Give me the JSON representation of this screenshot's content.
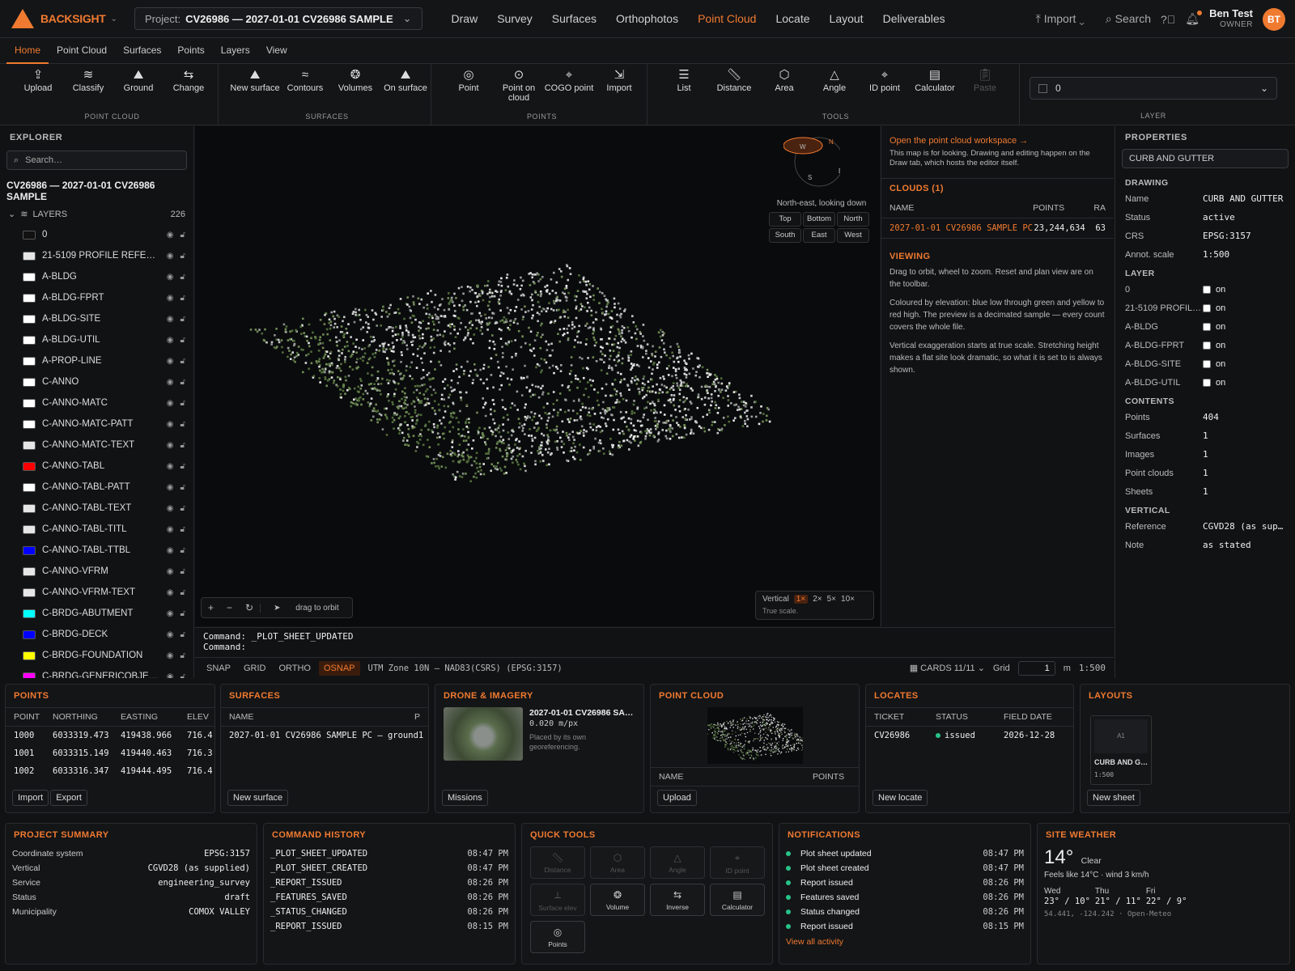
{
  "app": {
    "name": "BACKSIGHT",
    "project_label": "Project:",
    "project_value": "CV26986 — 2027-01-01 CV26986 SAMPLE"
  },
  "topnav": [
    "Draw",
    "Survey",
    "Surfaces",
    "Orthophotos",
    "Point Cloud",
    "Locate",
    "Layout",
    "Deliverables"
  ],
  "topnav_active": "Point Cloud",
  "topright": {
    "import": "Import",
    "search": "Search",
    "user_name": "Ben Test",
    "user_role": "OWNER",
    "avatar": "BT"
  },
  "tabs": [
    "Home",
    "Point Cloud",
    "Surfaces",
    "Points",
    "Layers",
    "View"
  ],
  "ribbon": {
    "groups": [
      {
        "label": "POINT CLOUD",
        "buttons": [
          {
            "label": "Upload",
            "icon": "upload-icon"
          },
          {
            "label": "Classify",
            "icon": "layers-icon"
          },
          {
            "label": "Ground",
            "icon": "mountain-icon"
          },
          {
            "label": "Change",
            "icon": "arrows-icon"
          }
        ]
      },
      {
        "label": "SURFACES",
        "buttons": [
          {
            "label": "New surface",
            "icon": "mountain-icon"
          },
          {
            "label": "Contours",
            "icon": "waves-icon"
          },
          {
            "label": "Volumes",
            "icon": "circles-icon"
          },
          {
            "label": "On surface",
            "icon": "mountain-icon"
          }
        ]
      },
      {
        "label": "POINTS",
        "buttons": [
          {
            "label": "Point",
            "icon": "target-icon"
          },
          {
            "label": "Point on cloud",
            "icon": "circle-dot-icon"
          },
          {
            "label": "COGO point",
            "icon": "crosshair-icon"
          },
          {
            "label": "Import",
            "icon": "import-icon"
          }
        ]
      },
      {
        "label": "TOOLS",
        "buttons": [
          {
            "label": "List",
            "icon": "list-icon"
          },
          {
            "label": "Distance",
            "icon": "ruler-icon"
          },
          {
            "label": "Area",
            "icon": "hexagon-icon"
          },
          {
            "label": "Angle",
            "icon": "angle-icon"
          },
          {
            "label": "ID point",
            "icon": "crosshair-icon"
          },
          {
            "label": "Calculator",
            "icon": "calculator-icon"
          },
          {
            "label": "Paste",
            "icon": "clipboard-icon"
          }
        ]
      }
    ],
    "layer_label": "LAYER",
    "layer_value": "0"
  },
  "explorer": {
    "title": "EXPLORER",
    "search_placeholder": "Search…",
    "project": "CV26986 — 2027-01-01 CV26986 SAMPLE",
    "layers_label": "LAYERS",
    "layers_count": "226",
    "layers": [
      {
        "name": "0",
        "color": "#111111"
      },
      {
        "name": "21-5109 PROFILE REFERE…",
        "color": "#e6e6e6"
      },
      {
        "name": "A-BLDG",
        "color": "#ffffff"
      },
      {
        "name": "A-BLDG-FPRT",
        "color": "#ffffff"
      },
      {
        "name": "A-BLDG-SITE",
        "color": "#ffffff"
      },
      {
        "name": "A-BLDG-UTIL",
        "color": "#ffffff"
      },
      {
        "name": "A-PROP-LINE",
        "color": "#ffffff"
      },
      {
        "name": "C-ANNO",
        "color": "#ffffff"
      },
      {
        "name": "C-ANNO-MATC",
        "color": "#ffffff"
      },
      {
        "name": "C-ANNO-MATC-PATT",
        "color": "#ffffff"
      },
      {
        "name": "C-ANNO-MATC-TEXT",
        "color": "#e6e6e6"
      },
      {
        "name": "C-ANNO-TABL",
        "color": "#ff0000"
      },
      {
        "name": "C-ANNO-TABL-PATT",
        "color": "#ffffff"
      },
      {
        "name": "C-ANNO-TABL-TEXT",
        "color": "#e6e6e6"
      },
      {
        "name": "C-ANNO-TABL-TITL",
        "color": "#e6e6e6"
      },
      {
        "name": "C-ANNO-TABL-TTBL",
        "color": "#0000ff"
      },
      {
        "name": "C-ANNO-VFRM",
        "color": "#e6e6e6"
      },
      {
        "name": "C-ANNO-VFRM-TEXT",
        "color": "#e6e6e6"
      },
      {
        "name": "C-BRDG-ABUTMENT",
        "color": "#00ffff"
      },
      {
        "name": "C-BRDG-DECK",
        "color": "#0000ff"
      },
      {
        "name": "C-BRDG-FOUNDATION",
        "color": "#ffff00"
      },
      {
        "name": "C-BRDG-GENERICOBJECT",
        "color": "#ff00ff"
      }
    ]
  },
  "viewer": {
    "compass_caption": "North-east, looking down",
    "view_buttons": [
      "Top",
      "Bottom",
      "North",
      "South",
      "East",
      "West"
    ],
    "compass_letters": [
      "N",
      "W",
      "E",
      "S"
    ],
    "drag_hint": "drag to orbit",
    "vertical_label": "Vertical",
    "vertical_options": [
      "1×",
      "2×",
      "5×",
      "10×"
    ],
    "vertical_active": "1×",
    "vertical_caption": "True scale."
  },
  "infopanel": {
    "link": "Open the point cloud workspace →",
    "note": "This map is for looking. Drawing and editing happen on the Draw tab, which hosts the editor itself.",
    "clouds_title": "CLOUDS (1)",
    "clouds_headers": [
      "NAME",
      "POINTS",
      "RA"
    ],
    "clouds_row": [
      "2027-01-01 CV26986 SAMPLE PC",
      "23,244,634",
      "63"
    ],
    "viewing_title": "VIEWING",
    "viewing_paragraphs": [
      "Drag to orbit, wheel to zoom. Reset and plan view are on the toolbar.",
      "Coloured by elevation: blue low through green and yellow to red high. The preview is a decimated sample — every count covers the whole file.",
      "Vertical exaggeration starts at true scale. Stretching height makes a flat site look dramatic, so what it is set to is always shown."
    ]
  },
  "properties": {
    "title": "PROPERTIES",
    "name_input": "CURB AND GUTTER",
    "drawing_title": "DRAWING",
    "drawing": [
      [
        "Name",
        "CURB AND GUTTER"
      ],
      [
        "Status",
        "active"
      ],
      [
        "CRS",
        "EPSG:3157"
      ],
      [
        "Annot. scale",
        "1:500"
      ]
    ],
    "layer_title": "LAYER",
    "layers": [
      [
        "0",
        "on"
      ],
      [
        "21-5109 PROFIL…",
        "on"
      ],
      [
        "A-BLDG",
        "on"
      ],
      [
        "A-BLDG-FPRT",
        "on"
      ],
      [
        "A-BLDG-SITE",
        "on"
      ],
      [
        "A-BLDG-UTIL",
        "on"
      ]
    ],
    "contents_title": "CONTENTS",
    "contents": [
      [
        "Points",
        "404"
      ],
      [
        "Surfaces",
        "1"
      ],
      [
        "Images",
        "1"
      ],
      [
        "Point clouds",
        "1"
      ],
      [
        "Sheets",
        "1"
      ]
    ],
    "vertical_title": "VERTICAL",
    "vertical": [
      [
        "Reference",
        "CGVD28 (as sup…"
      ],
      [
        "Note",
        "as stated"
      ]
    ]
  },
  "command": {
    "line1_label": "Command:",
    "line1_value": "_PLOT_SHEET_UPDATED",
    "line2_label": "Command:"
  },
  "statusbar": {
    "toggles": [
      "SNAP",
      "GRID",
      "ORTHO",
      "OSNAP"
    ],
    "active_toggle": "OSNAP",
    "crs": "UTM Zone 10N — NAD83(CSRS) (EPSG:3157)",
    "cards": "CARDS 11/11",
    "grid_label": "Grid",
    "grid_value": "1",
    "grid_unit": "m",
    "scale": "1:500"
  },
  "cards": {
    "points": {
      "title": "POINTS",
      "headers": [
        "POINT",
        "NORTHING",
        "EASTING",
        "ELEV"
      ],
      "rows": [
        [
          "1000",
          "6033319.473",
          "419438.966",
          "716.4"
        ],
        [
          "1001",
          "6033315.149",
          "419440.463",
          "716.3"
        ],
        [
          "1002",
          "6033316.347",
          "419444.495",
          "716.4"
        ]
      ],
      "buttons": [
        "Import",
        "Export"
      ]
    },
    "surfaces": {
      "title": "SURFACES",
      "headers": [
        "NAME",
        "P"
      ],
      "rows": [
        [
          "2027-01-01 CV26986 SAMPLE PC — ground",
          "1"
        ]
      ],
      "button": "New surface"
    },
    "drone": {
      "title": "DRONE & IMAGERY",
      "name": "2027-01-01 CV26986 SAM…",
      "gsd": "0.020 m/px",
      "note": "Placed by its own georeferencing.",
      "button": "Missions"
    },
    "pointcloud": {
      "title": "POINT CLOUD",
      "headers": [
        "NAME",
        "POINTS"
      ],
      "button": "Upload"
    },
    "locates": {
      "title": "LOCATES",
      "headers": [
        "TICKET",
        "STATUS",
        "FIELD DATE"
      ],
      "rows": [
        [
          "CV26986",
          "issued",
          "2026-12-28"
        ]
      ],
      "button": "New locate"
    },
    "layouts": {
      "title": "LAYOUTS",
      "sheet_code": "A1",
      "sheet_name": "CURB AND G…",
      "sheet_scale": "1:500",
      "button": "New sheet"
    },
    "summary": {
      "title": "PROJECT SUMMARY",
      "rows": [
        [
          "Coordinate system",
          "EPSG:3157"
        ],
        [
          "Vertical",
          "CGVD28 (as supplied)"
        ],
        [
          "Service",
          "engineering_survey"
        ],
        [
          "Status",
          "draft"
        ],
        [
          "Municipality",
          "COMOX VALLEY"
        ]
      ]
    },
    "history": {
      "title": "COMMAND HISTORY",
      "rows": [
        [
          "_PLOT_SHEET_UPDATED",
          "08:47 PM"
        ],
        [
          "_PLOT_SHEET_CREATED",
          "08:47 PM"
        ],
        [
          "_REPORT_ISSUED",
          "08:26 PM"
        ],
        [
          "_FEATURES_SAVED",
          "08:26 PM"
        ],
        [
          "_STATUS_CHANGED",
          "08:26 PM"
        ],
        [
          "_REPORT_ISSUED",
          "08:15 PM"
        ]
      ]
    },
    "quicktools": {
      "title": "QUICK TOOLS",
      "tools": [
        {
          "label": "Distance",
          "enabled": false,
          "icon": "ruler-icon"
        },
        {
          "label": "Area",
          "enabled": false,
          "icon": "hexagon-icon"
        },
        {
          "label": "Angle",
          "enabled": false,
          "icon": "angle-icon"
        },
        {
          "label": "ID point",
          "enabled": false,
          "icon": "crosshair-icon"
        },
        {
          "label": "Surface elev",
          "enabled": false,
          "icon": "elevation-icon"
        },
        {
          "label": "Volume",
          "enabled": true,
          "icon": "circles-icon"
        },
        {
          "label": "Inverse",
          "enabled": true,
          "icon": "arrows-icon"
        },
        {
          "label": "Calculator",
          "enabled": true,
          "icon": "calculator-icon"
        },
        {
          "label": "Points",
          "enabled": true,
          "icon": "target-icon"
        }
      ]
    },
    "notifications": {
      "title": "NOTIFICATIONS",
      "rows": [
        [
          "Plot sheet updated",
          "08:47 PM"
        ],
        [
          "Plot sheet created",
          "08:47 PM"
        ],
        [
          "Report issued",
          "08:26 PM"
        ],
        [
          "Features saved",
          "08:26 PM"
        ],
        [
          "Status changed",
          "08:26 PM"
        ],
        [
          "Report issued",
          "08:15 PM"
        ]
      ],
      "link": "View all activity"
    },
    "weather": {
      "title": "SITE WEATHER",
      "temp": "14°",
      "cond": "Clear",
      "feels": "Feels like 14°C · wind 3 km/h",
      "days": [
        [
          "Wed",
          "23° / 10°"
        ],
        [
          "Thu",
          "21° / 11°"
        ],
        [
          "Fri",
          "22° / 9°"
        ]
      ],
      "coords": "54.441, -124.242 · Open-Meteo"
    }
  },
  "colors": {
    "accent": "#f07a30",
    "success": "#27c489",
    "bg": "#111214"
  }
}
